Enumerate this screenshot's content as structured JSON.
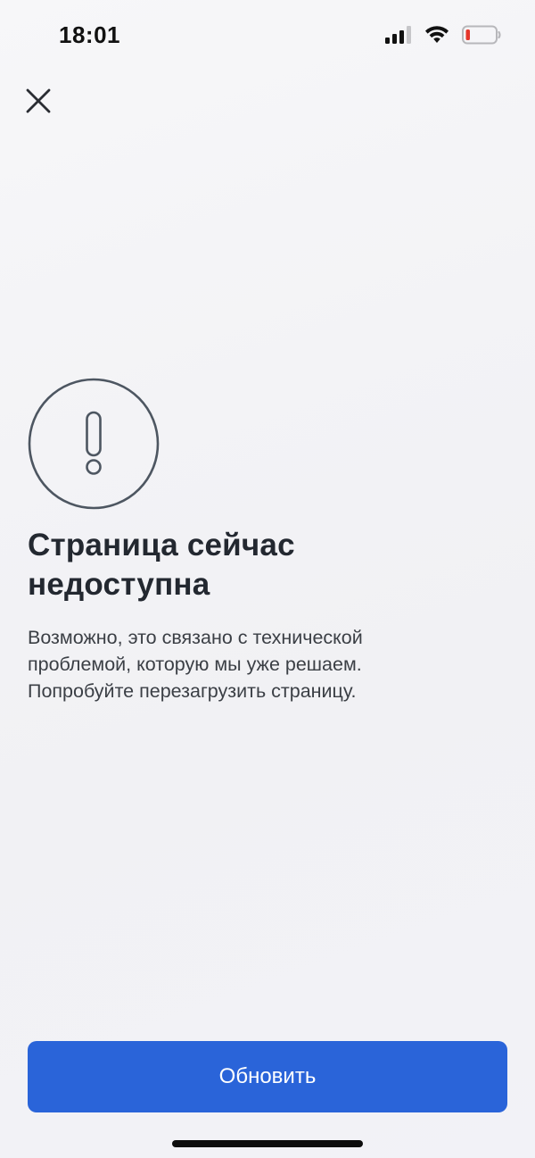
{
  "status_bar": {
    "time": "18:01",
    "signal_icon": "cellular-signal-icon",
    "wifi_icon": "wifi-icon",
    "battery_icon": "battery-low-icon",
    "battery_level_fraction": 0.1,
    "battery_alert_color": "#e5362b"
  },
  "header": {
    "close_icon": "close-icon"
  },
  "error": {
    "icon": "exclamation-circle-icon",
    "title_line1": "Страница сейчас",
    "title_line2": "недоступна",
    "description_line1": "Возможно, это связано с технической",
    "description_line2": "проблемой, которую мы уже решаем.",
    "description_line3": "Попробуйте перезагрузить страницу."
  },
  "actions": {
    "refresh_label": "Обновить",
    "accent_color": "#2a64d9"
  }
}
